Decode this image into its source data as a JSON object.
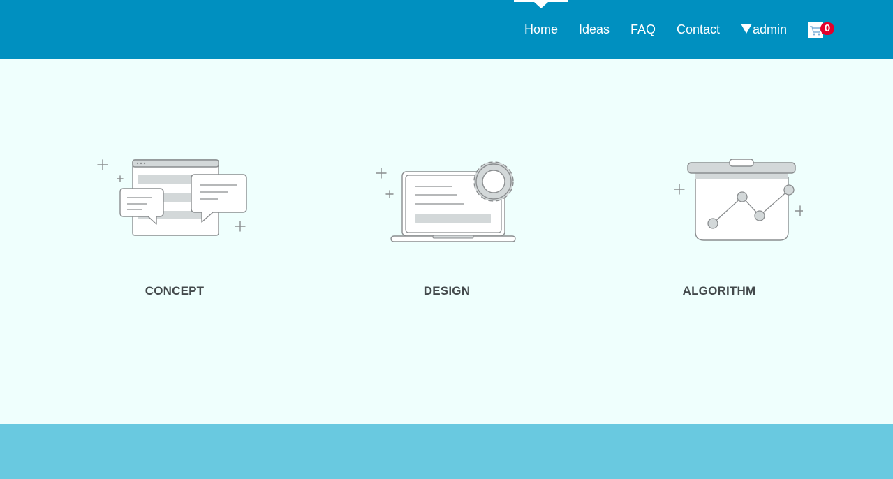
{
  "nav": {
    "items": [
      {
        "label": "Home",
        "active": true
      },
      {
        "label": "Ideas"
      },
      {
        "label": "FAQ"
      },
      {
        "label": "Contact"
      }
    ],
    "user_menu": {
      "label": "admin",
      "icon": "caret-down-icon"
    },
    "cart": {
      "icon": "cart-icon",
      "count": "0"
    }
  },
  "features": [
    {
      "label": "CONCEPT",
      "icon": "chat-window-icon"
    },
    {
      "label": "DESIGN",
      "icon": "laptop-gear-icon"
    },
    {
      "label": "ALGORITHM",
      "icon": "chart-board-icon"
    }
  ],
  "colors": {
    "header_bg": "#0090c0",
    "page_bg": "#effffd",
    "footer_bg": "#69c9e0",
    "badge_bg": "#e4002b",
    "label_text": "#444a4c",
    "icon_stroke": "#8a8d8f",
    "icon_fill": "#d3d8d9"
  }
}
